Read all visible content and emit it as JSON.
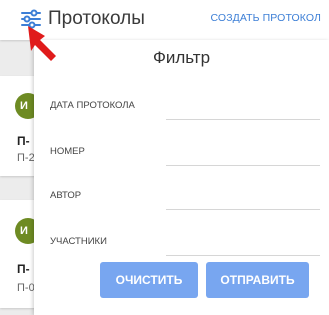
{
  "header": {
    "title": "Протоколы",
    "create_label": "СОЗДАТЬ ПРОТОКОЛ",
    "filter_icon": "filter-sliders-icon"
  },
  "cards": [
    {
      "avatar": "И",
      "title": "П-",
      "subtitle": "П-2"
    },
    {
      "avatar": "И",
      "title": "П-",
      "subtitle": "П-0"
    }
  ],
  "filter": {
    "title": "Фильтр",
    "fields": [
      {
        "label": "ДАТА ПРОТОКОЛА"
      },
      {
        "label": "НОМЕР"
      },
      {
        "label": "АВТОР"
      },
      {
        "label": "УЧАСТНИКИ"
      }
    ],
    "clear_label": "ОЧИСТИТЬ",
    "submit_label": "ОТПРАВИТЬ"
  },
  "colors": {
    "accent": "#3d7fd6",
    "button": "#78a6f0",
    "avatar": "#6e8b23",
    "annotation_arrow": "#e01b1b"
  }
}
